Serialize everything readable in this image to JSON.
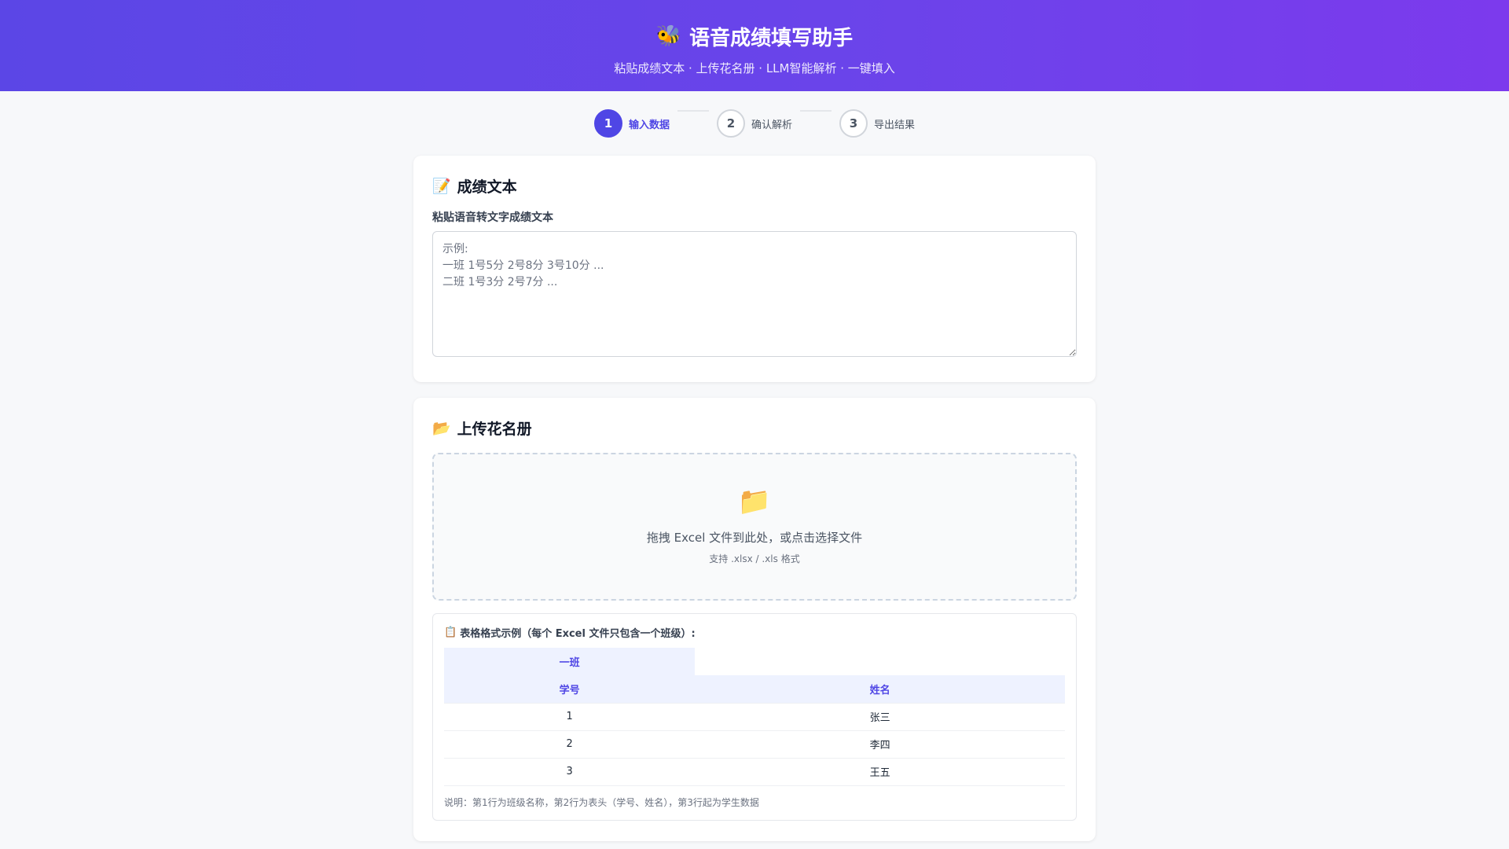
{
  "header": {
    "icon": "bee-icon",
    "title": "语音成绩填写助手",
    "subtitle": "粘贴成绩文本 · 上传花名册 · LLM智能解析 · 一键填入"
  },
  "steps": [
    {
      "number": "1",
      "label": "输入数据",
      "active": true
    },
    {
      "number": "2",
      "label": "确认解析",
      "active": false
    },
    {
      "number": "3",
      "label": "导出结果",
      "active": false
    }
  ],
  "score_card": {
    "icon": "memo-icon",
    "title": "成绩文本",
    "field_label": "粘贴语音转文字成绩文本",
    "placeholder": "示例:\n一班 1号5分 2号8分 3号10分 ...\n二班 1号3分 2号7分 ...",
    "value": ""
  },
  "roster_card": {
    "icon": "open-folder-icon",
    "title": "上传花名册",
    "dropzone": {
      "icon": "folder-icon",
      "main_text": "拖拽 Excel 文件到此处，或点击选择文件",
      "sub_text": "支持 .xlsx / .xls 格式"
    },
    "example": {
      "icon": "clipboard-icon",
      "title": "表格格式示例（每个 Excel 文件只包含一个班级）:",
      "class_name": "一班",
      "headers": [
        "学号",
        "姓名"
      ],
      "rows": [
        [
          "1",
          "张三"
        ],
        [
          "2",
          "李四"
        ],
        [
          "3",
          "王五"
        ]
      ],
      "note": "说明：第1行为班级名称，第2行为表头（学号、姓名），第3行起为学生数据"
    }
  },
  "colors": {
    "accent": "#4f46e5",
    "header_gradient_start": "#5b46e6",
    "header_gradient_end": "#7c3aed"
  }
}
